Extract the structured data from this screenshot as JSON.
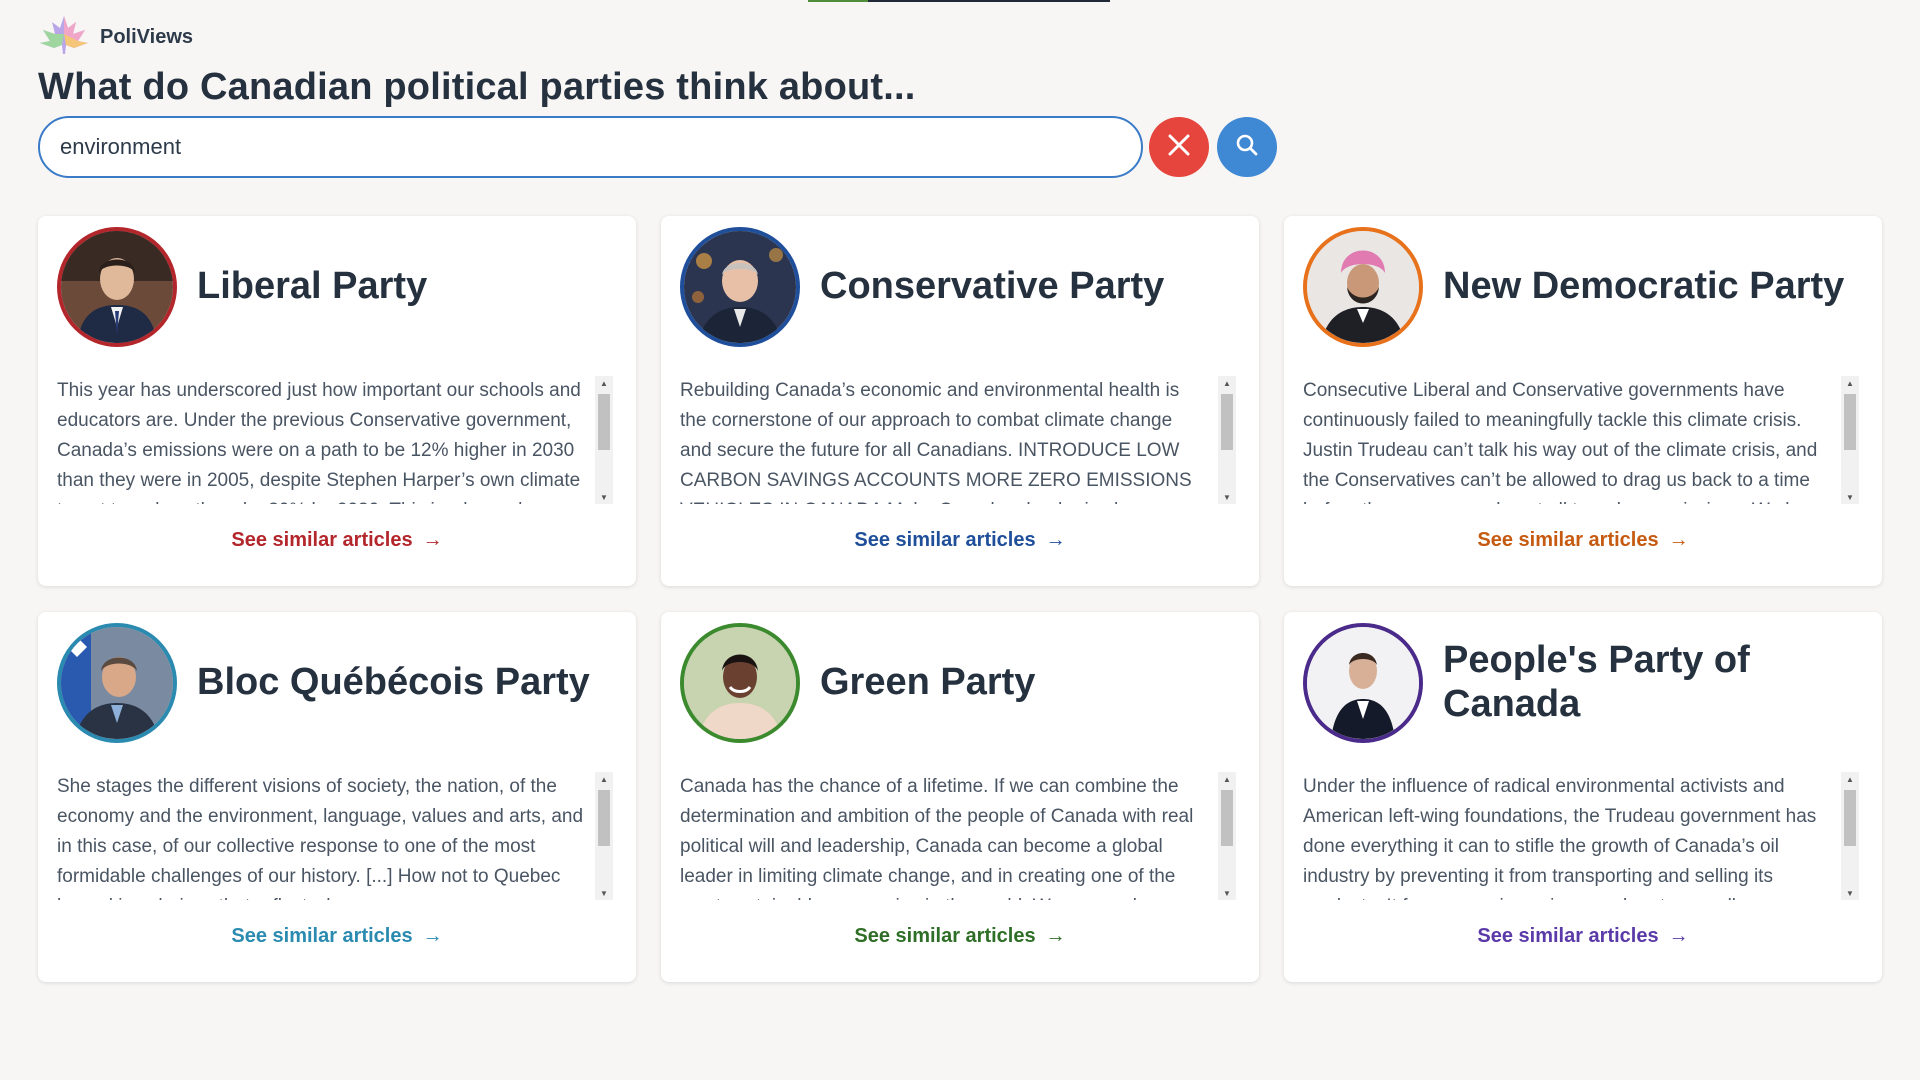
{
  "app": {
    "name": "PoliViews",
    "logo_icon": "maple-leaf-icon"
  },
  "headline": "What do Canadian political parties think about...",
  "search": {
    "value": "environment",
    "clear_icon": "close-icon",
    "search_icon": "search-icon",
    "clear_color": "#e5453d",
    "search_color": "#3f88d4"
  },
  "parties": [
    {
      "name": "Liberal Party",
      "color": "#b3262b",
      "excerpt": "This year has underscored just how important our schools and educators are. Under the previous Conservative government, Canada’s emissions were on a path to be 12% higher in 2030 than they were in 2005, despite Stephen Harper’s own climate target to reduce them by 30% by 2030. This is why we have taken action.",
      "link": "See similar articles"
    },
    {
      "name": "Conservative Party",
      "color": "#1f4f9a",
      "excerpt": "Rebuilding Canada’s economic and environmental health is the cornerstone of our approach to combat climate change and secure the future for all Canadians. INTRODUCE LOW CARBON SAVINGS ACCOUNTS MORE ZERO EMISSIONS VEHICLES IN CANADA Make Canada a leader in clean technology.",
      "link": "See similar articles"
    },
    {
      "name": "New Democratic Party",
      "color": "#e8711c",
      "excerpt": "Consecutive Liberal and Conservative governments have continuously failed to meaningfully tackle this climate crisis. Justin Trudeau can’t talk his way out of the climate crisis, and the Conservatives can’t be allowed to drag us back to a time before there was any plan at all to reduce emissions. We know we can do better.",
      "link": "See similar articles"
    },
    {
      "name": "Bloc Québécois Party",
      "color": "#2a8ab0",
      "excerpt": "She stages the different visions of society, the nation, of the economy and the environment, language, values and arts, and in this case, of our collective response to one of the most formidable challenges of our history. [...] How not to Quebec by making choices that reflect who we are.",
      "link": "See similar articles"
    },
    {
      "name": "Green Party",
      "color": "#3c8a2e",
      "excerpt": "Canada has the chance of a lifetime. If we can combine the determination and ambition of the people of Canada with real political will and leadership, Canada can become a global leader in limiting climate change, and in creating one of the most sustainable economies in the world. We are ready.",
      "link": "See similar articles"
    },
    {
      "name": "People's Party of Canada",
      "color": "#4a2a8a",
      "excerpt": "Under the influence of radical environmental activists and American left-wing foundations, the Trudeau government has done everything it can to stifle the growth of Canada’s oil industry by preventing it from transporting and selling its products. It focuses on imposing a carbon tax on all Canadians.",
      "link": "See similar articles"
    }
  ]
}
